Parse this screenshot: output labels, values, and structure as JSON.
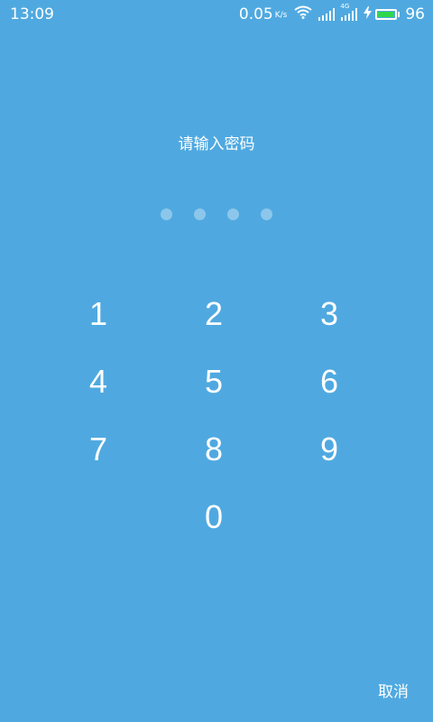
{
  "status_bar": {
    "time": "13:09",
    "net_speed": "0.05",
    "net_speed_unit": "K/s",
    "network_type": "4G",
    "battery_level": 96,
    "battery_text": "96",
    "charging": true,
    "icons": [
      "wifi-icon",
      "signal-icon",
      "signal-4g-icon",
      "charging-icon",
      "battery-icon"
    ]
  },
  "lock": {
    "prompt": "请输入密码",
    "pin_length": 4,
    "keys": [
      "1",
      "2",
      "3",
      "4",
      "5",
      "6",
      "7",
      "8",
      "9",
      "0"
    ],
    "cancel_label": "取消"
  },
  "colors": {
    "background": "#4fa9e0",
    "text": "#ffffff",
    "battery_fill": "#2fd84a"
  }
}
